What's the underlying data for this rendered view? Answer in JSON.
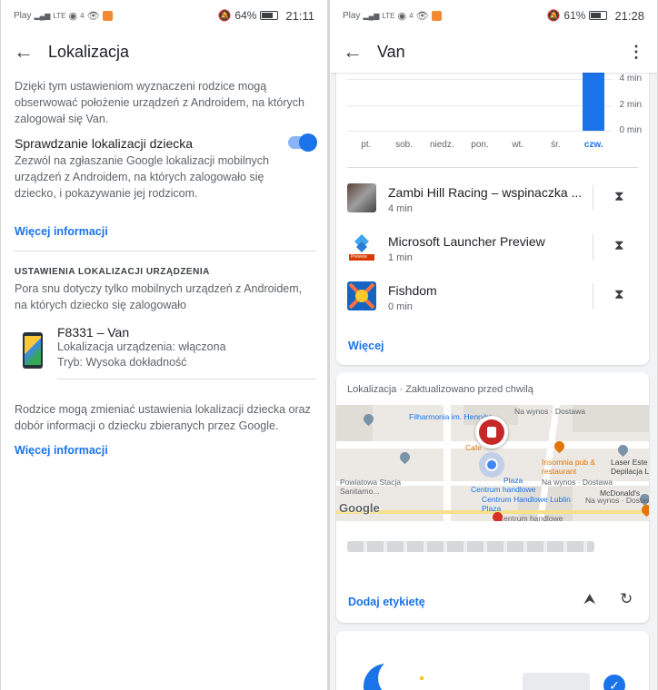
{
  "left": {
    "status": {
      "operator": "Play",
      "signal": "LTE",
      "wifi_badge": "4",
      "battery": "64%",
      "time": "21:11",
      "battery_level": 0.64
    },
    "title": "Lokalizacja",
    "intro": "Dzięki tym ustawieniom wyznaczeni rodzice mogą obserwować położenie urządzeń z Androidem, na których zalogował się Van.",
    "setting": {
      "title": "Sprawdzanie lokalizacji dziecka",
      "description": "Zezwól na zgłaszanie Google lokalizacji mobilnych urządzeń z Androidem, na których zalogowało się dziecko, i pokazywanie jej rodzicom.",
      "enabled": true
    },
    "more_info_1": "Więcej informacji",
    "section_header": "USTAWIENIA LOKALIZACJI URZĄDZENIA",
    "section_desc": "Pora snu dotyczy tylko mobilnych urządzeń z Androidem, na których dziecko się zalogowało",
    "device": {
      "name": "F8331 – Van",
      "location": "Lokalizacja urządzenia: włączona",
      "mode": "Tryb: Wysoka dokładność"
    },
    "footer_text": "Rodzice mogą zmieniać ustawienia lokalizacji dziecka oraz dobór informacji o dziecku zbieranych przez Google.",
    "more_info_2": "Więcej informacji"
  },
  "right": {
    "status": {
      "operator": "Play",
      "signal": "LTE",
      "wifi_badge": "4",
      "battery": "61%",
      "time": "21:28",
      "battery_level": 0.61
    },
    "title": "Van",
    "chart_data": {
      "type": "bar",
      "categories": [
        "pt.",
        "sob.",
        "niedz.",
        "pon.",
        "wt.",
        "śr.",
        "czw."
      ],
      "y_ticks": [
        "4 min",
        "2 min",
        "0 min"
      ],
      "values": [
        0,
        0,
        0,
        0,
        0,
        0,
        4.5
      ],
      "selected": "czw.",
      "ylim": [
        0,
        4.5
      ],
      "grid": true
    },
    "apps": [
      {
        "name": "Zambi Hill Racing – wspinaczka ...",
        "time": "4 min",
        "icon": "car-game-icon"
      },
      {
        "name": "Microsoft Launcher Preview",
        "time": "1 min",
        "icon": "microsoft-launcher-icon",
        "badge": "Preview"
      },
      {
        "name": "Fishdom",
        "time": "0 min",
        "icon": "fishdom-icon"
      }
    ],
    "more_link": "Więcej",
    "location": {
      "header": "Lokalizacja · Zaktualizowano przed chwilą",
      "map_labels": {
        "filharmonia": "Filharmonia im. Henryka",
        "cafe": "Cafe",
        "station": "Powiatowa Stacja Sanitarno...",
        "insomnia": "Insomnia pub & restaurant",
        "insomnia_sub": "Na wynos · Dostawa",
        "plaza": "Plaza",
        "plaza_sub": "Centrum handlowe",
        "centrum": "Centrum Handlowe Lublin Plaza",
        "centrum_sub": "Centrum handlowe",
        "laser": "Laser Este Depilacja L",
        "mcdonalds": "McDonald's",
        "mcd_sub": "Na wynos · Dostawa",
        "top_delivery": "Na wynos · Dostawa",
        "google": "Google"
      },
      "add_label": "Dodaj etykietę"
    }
  }
}
